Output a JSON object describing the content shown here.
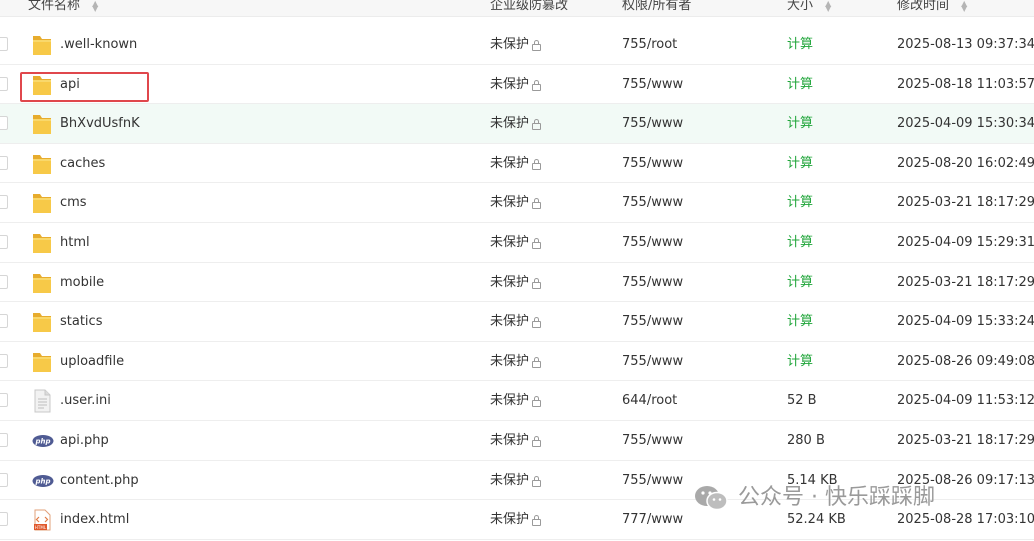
{
  "header": {
    "col_name": "文件名称",
    "col_protection": "企业级防篡改",
    "col_permission": "权限/所有者",
    "col_size": "大小",
    "col_mtime": "修改时间"
  },
  "rows": [
    {
      "name": ".well-known",
      "type": "folder",
      "protection": "未保护",
      "permission": "755/root",
      "size": "计算",
      "mtime": "2025-08-13 09:37:34"
    },
    {
      "name": "api",
      "type": "folder",
      "protection": "未保护",
      "permission": "755/www",
      "size": "计算",
      "mtime": "2025-08-18 11:03:57"
    },
    {
      "name": "BhXvdUsfnK",
      "type": "folder",
      "protection": "未保护",
      "permission": "755/www",
      "size": "计算",
      "mtime": "2025-04-09 15:30:34"
    },
    {
      "name": "caches",
      "type": "folder",
      "protection": "未保护",
      "permission": "755/www",
      "size": "计算",
      "mtime": "2025-08-20 16:02:49"
    },
    {
      "name": "cms",
      "type": "folder",
      "protection": "未保护",
      "permission": "755/www",
      "size": "计算",
      "mtime": "2025-03-21 18:17:29"
    },
    {
      "name": "html",
      "type": "folder",
      "protection": "未保护",
      "permission": "755/www",
      "size": "计算",
      "mtime": "2025-04-09 15:29:31"
    },
    {
      "name": "mobile",
      "type": "folder",
      "protection": "未保护",
      "permission": "755/www",
      "size": "计算",
      "mtime": "2025-03-21 18:17:29"
    },
    {
      "name": "statics",
      "type": "folder",
      "protection": "未保护",
      "permission": "755/www",
      "size": "计算",
      "mtime": "2025-04-09 15:33:24"
    },
    {
      "name": "uploadfile",
      "type": "folder",
      "protection": "未保护",
      "permission": "755/www",
      "size": "计算",
      "mtime": "2025-08-26 09:49:08"
    },
    {
      "name": ".user.ini",
      "type": "file",
      "protection": "未保护",
      "permission": "644/root",
      "size": "52 B",
      "mtime": "2025-04-09 11:53:12"
    },
    {
      "name": "api.php",
      "type": "php",
      "protection": "未保护",
      "permission": "755/www",
      "size": "280 B",
      "mtime": "2025-03-21 18:17:29"
    },
    {
      "name": "content.php",
      "type": "php",
      "protection": "未保护",
      "permission": "755/www",
      "size": "5.14 KB",
      "mtime": "2025-08-26 09:17:13"
    },
    {
      "name": "index.html",
      "type": "html",
      "protection": "未保护",
      "permission": "777/www",
      "size": "52.24 KB",
      "mtime": "2025-08-28 17:03:10"
    }
  ],
  "php_badge": "php",
  "html_badge": "HTML",
  "watermark": "公众号 · 快乐踩踩脚",
  "colors": {
    "accent_green": "#20a53a",
    "highlight_box": "#e0474c",
    "folder_yellow": "#f5c342",
    "php_badge": "#4f5b93"
  }
}
